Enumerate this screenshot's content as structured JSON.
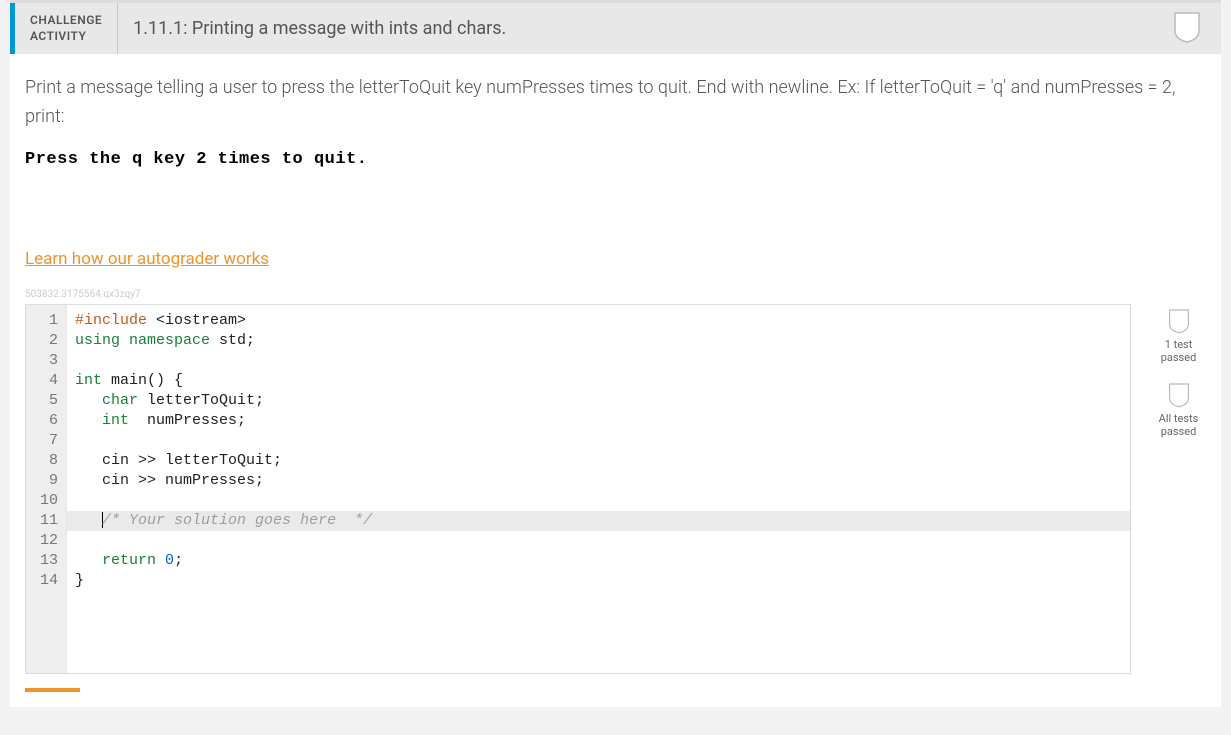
{
  "header": {
    "badge_line1": "CHALLENGE",
    "badge_line2": "ACTIVITY",
    "title": "1.11.1: Printing a message with ints and chars."
  },
  "prompt": {
    "text": "Print a message telling a user to press the letterToQuit key numPresses times to quit. End with newline. Ex: If letterToQuit = 'q' and numPresses = 2, print:",
    "sample": "Press the q key 2 times to quit."
  },
  "links": {
    "autograder": "Learn how our autograder works"
  },
  "watermark": "503832.3175564.qx3zqy7",
  "code": {
    "line_numbers": [
      "1",
      "2",
      "3",
      "4",
      "5",
      "6",
      "7",
      "8",
      "9",
      "10",
      "11",
      "12",
      "13",
      "14"
    ],
    "raw": "#include <iostream>\nusing namespace std;\n\nint main() {\n   char letterToQuit;\n   int  numPresses;\n\n   cin >> letterToQuit;\n   cin >> numPresses;\n\n   /* Your solution goes here  */\n\n   return 0;\n}",
    "tokens": [
      [
        {
          "t": "#include ",
          "c": "tk-pp"
        },
        {
          "t": "<iostream>",
          "c": ""
        }
      ],
      [
        {
          "t": "using ",
          "c": "tk-kw"
        },
        {
          "t": "namespace ",
          "c": "tk-kw"
        },
        {
          "t": "std;",
          "c": ""
        }
      ],
      [
        {
          "t": "",
          "c": ""
        }
      ],
      [
        {
          "t": "int ",
          "c": "tk-kw"
        },
        {
          "t": "main() {",
          "c": ""
        }
      ],
      [
        {
          "t": "   ",
          "c": ""
        },
        {
          "t": "char ",
          "c": "tk-kw"
        },
        {
          "t": "letterToQuit;",
          "c": ""
        }
      ],
      [
        {
          "t": "   ",
          "c": ""
        },
        {
          "t": "int  ",
          "c": "tk-kw"
        },
        {
          "t": "numPresses;",
          "c": ""
        }
      ],
      [
        {
          "t": "",
          "c": ""
        }
      ],
      [
        {
          "t": "   cin >> letterToQuit;",
          "c": ""
        }
      ],
      [
        {
          "t": "   cin >> numPresses;",
          "c": ""
        }
      ],
      [
        {
          "t": "",
          "c": ""
        }
      ],
      [
        {
          "t": "   ",
          "c": ""
        },
        {
          "t": "/* Your solution goes here  */",
          "c": "tk-cm"
        }
      ],
      [
        {
          "t": "",
          "c": ""
        }
      ],
      [
        {
          "t": "   ",
          "c": ""
        },
        {
          "t": "return ",
          "c": "tk-kw"
        },
        {
          "t": "0",
          "c": "tk-num"
        },
        {
          "t": ";",
          "c": ""
        }
      ],
      [
        {
          "t": "}",
          "c": ""
        }
      ]
    ],
    "active_line_index": 10
  },
  "side": {
    "badge1": "1 test passed",
    "badge2": "All tests passed"
  }
}
